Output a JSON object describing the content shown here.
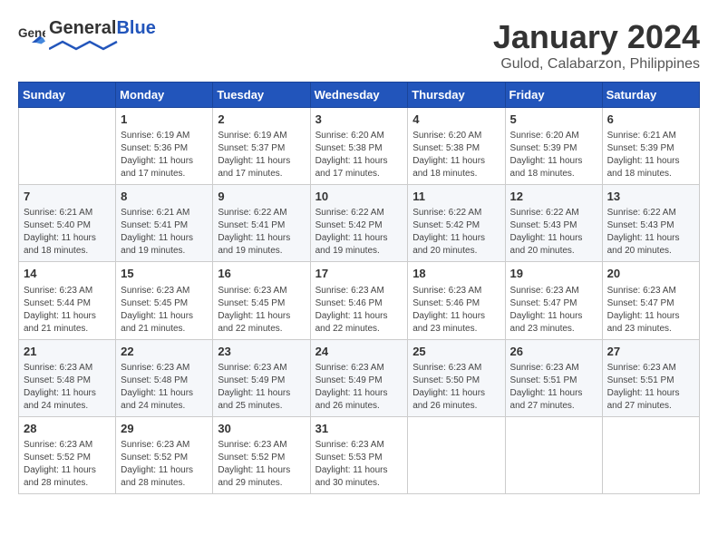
{
  "header": {
    "logo_general": "General",
    "logo_blue": "Blue",
    "month_year": "January 2024",
    "location": "Gulod, Calabarzon, Philippines"
  },
  "weekdays": [
    "Sunday",
    "Monday",
    "Tuesday",
    "Wednesday",
    "Thursday",
    "Friday",
    "Saturday"
  ],
  "weeks": [
    [
      {
        "day": "",
        "info": ""
      },
      {
        "day": "1",
        "info": "Sunrise: 6:19 AM\nSunset: 5:36 PM\nDaylight: 11 hours and 17 minutes."
      },
      {
        "day": "2",
        "info": "Sunrise: 6:19 AM\nSunset: 5:37 PM\nDaylight: 11 hours and 17 minutes."
      },
      {
        "day": "3",
        "info": "Sunrise: 6:20 AM\nSunset: 5:38 PM\nDaylight: 11 hours and 17 minutes."
      },
      {
        "day": "4",
        "info": "Sunrise: 6:20 AM\nSunset: 5:38 PM\nDaylight: 11 hours and 18 minutes."
      },
      {
        "day": "5",
        "info": "Sunrise: 6:20 AM\nSunset: 5:39 PM\nDaylight: 11 hours and 18 minutes."
      },
      {
        "day": "6",
        "info": "Sunrise: 6:21 AM\nSunset: 5:39 PM\nDaylight: 11 hours and 18 minutes."
      }
    ],
    [
      {
        "day": "7",
        "info": "Sunrise: 6:21 AM\nSunset: 5:40 PM\nDaylight: 11 hours and 18 minutes."
      },
      {
        "day": "8",
        "info": "Sunrise: 6:21 AM\nSunset: 5:41 PM\nDaylight: 11 hours and 19 minutes."
      },
      {
        "day": "9",
        "info": "Sunrise: 6:22 AM\nSunset: 5:41 PM\nDaylight: 11 hours and 19 minutes."
      },
      {
        "day": "10",
        "info": "Sunrise: 6:22 AM\nSunset: 5:42 PM\nDaylight: 11 hours and 19 minutes."
      },
      {
        "day": "11",
        "info": "Sunrise: 6:22 AM\nSunset: 5:42 PM\nDaylight: 11 hours and 20 minutes."
      },
      {
        "day": "12",
        "info": "Sunrise: 6:22 AM\nSunset: 5:43 PM\nDaylight: 11 hours and 20 minutes."
      },
      {
        "day": "13",
        "info": "Sunrise: 6:22 AM\nSunset: 5:43 PM\nDaylight: 11 hours and 20 minutes."
      }
    ],
    [
      {
        "day": "14",
        "info": "Sunrise: 6:23 AM\nSunset: 5:44 PM\nDaylight: 11 hours and 21 minutes."
      },
      {
        "day": "15",
        "info": "Sunrise: 6:23 AM\nSunset: 5:45 PM\nDaylight: 11 hours and 21 minutes."
      },
      {
        "day": "16",
        "info": "Sunrise: 6:23 AM\nSunset: 5:45 PM\nDaylight: 11 hours and 22 minutes."
      },
      {
        "day": "17",
        "info": "Sunrise: 6:23 AM\nSunset: 5:46 PM\nDaylight: 11 hours and 22 minutes."
      },
      {
        "day": "18",
        "info": "Sunrise: 6:23 AM\nSunset: 5:46 PM\nDaylight: 11 hours and 23 minutes."
      },
      {
        "day": "19",
        "info": "Sunrise: 6:23 AM\nSunset: 5:47 PM\nDaylight: 11 hours and 23 minutes."
      },
      {
        "day": "20",
        "info": "Sunrise: 6:23 AM\nSunset: 5:47 PM\nDaylight: 11 hours and 23 minutes."
      }
    ],
    [
      {
        "day": "21",
        "info": "Sunrise: 6:23 AM\nSunset: 5:48 PM\nDaylight: 11 hours and 24 minutes."
      },
      {
        "day": "22",
        "info": "Sunrise: 6:23 AM\nSunset: 5:48 PM\nDaylight: 11 hours and 24 minutes."
      },
      {
        "day": "23",
        "info": "Sunrise: 6:23 AM\nSunset: 5:49 PM\nDaylight: 11 hours and 25 minutes."
      },
      {
        "day": "24",
        "info": "Sunrise: 6:23 AM\nSunset: 5:49 PM\nDaylight: 11 hours and 26 minutes."
      },
      {
        "day": "25",
        "info": "Sunrise: 6:23 AM\nSunset: 5:50 PM\nDaylight: 11 hours and 26 minutes."
      },
      {
        "day": "26",
        "info": "Sunrise: 6:23 AM\nSunset: 5:51 PM\nDaylight: 11 hours and 27 minutes."
      },
      {
        "day": "27",
        "info": "Sunrise: 6:23 AM\nSunset: 5:51 PM\nDaylight: 11 hours and 27 minutes."
      }
    ],
    [
      {
        "day": "28",
        "info": "Sunrise: 6:23 AM\nSunset: 5:52 PM\nDaylight: 11 hours and 28 minutes."
      },
      {
        "day": "29",
        "info": "Sunrise: 6:23 AM\nSunset: 5:52 PM\nDaylight: 11 hours and 28 minutes."
      },
      {
        "day": "30",
        "info": "Sunrise: 6:23 AM\nSunset: 5:52 PM\nDaylight: 11 hours and 29 minutes."
      },
      {
        "day": "31",
        "info": "Sunrise: 6:23 AM\nSunset: 5:53 PM\nDaylight: 11 hours and 30 minutes."
      },
      {
        "day": "",
        "info": ""
      },
      {
        "day": "",
        "info": ""
      },
      {
        "day": "",
        "info": ""
      }
    ]
  ]
}
